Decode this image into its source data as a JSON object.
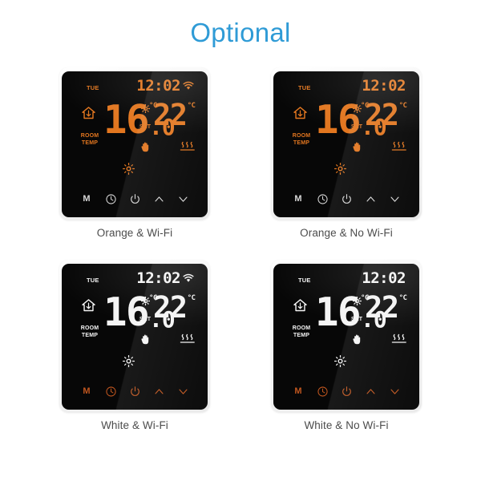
{
  "header": {
    "title": "Optional",
    "title_color": "#2f9bd6"
  },
  "colors": {
    "orange_display": "#e2761f",
    "white_display": "#f4f4f4",
    "orange_keys": "#c0561f",
    "white_keys": "#d8d8d8",
    "page_background": "#ffffff",
    "caption_text": "#4c4c4c",
    "glass": "#070707"
  },
  "display_common": {
    "weekday": "TUE",
    "time": "12:02",
    "room_temp_value": "16",
    "room_temp_fraction": ".0",
    "room_temp_unit": "°C",
    "room_temp_label_line1": "ROOM",
    "room_temp_label_line2": "TEMP",
    "set_label": "SET",
    "set_temp_value": "22",
    "set_temp_unit": "°C",
    "icons": {
      "house": "house-icon",
      "wifi": "wifi-icon",
      "gear": "gear-icon",
      "hand": "hand-manual-icon",
      "heating": "heating-waves-icon",
      "sun": "sun-icon"
    }
  },
  "keys": [
    {
      "name": "menu-key",
      "glyph": "M",
      "label": "M"
    },
    {
      "name": "clock-key",
      "glyph": "clock",
      "label": "Clock"
    },
    {
      "name": "power-key",
      "glyph": "power",
      "label": "Power"
    },
    {
      "name": "up-key",
      "glyph": "chevron-up",
      "label": "Up"
    },
    {
      "name": "down-key",
      "glyph": "chevron-down",
      "label": "Down"
    }
  ],
  "products": [
    {
      "id": "orange-wifi",
      "caption": "Orange & Wi-Fi",
      "display_color": "orange",
      "key_color": "white",
      "wifi": true
    },
    {
      "id": "orange-no-wifi",
      "caption": "Orange & No Wi-Fi",
      "display_color": "orange",
      "key_color": "white",
      "wifi": false
    },
    {
      "id": "white-wifi",
      "caption": "White & Wi-Fi",
      "display_color": "white",
      "key_color": "orange",
      "wifi": true
    },
    {
      "id": "white-no-wifi",
      "caption": "White & No Wi-Fi",
      "display_color": "white",
      "key_color": "orange",
      "wifi": false
    }
  ]
}
